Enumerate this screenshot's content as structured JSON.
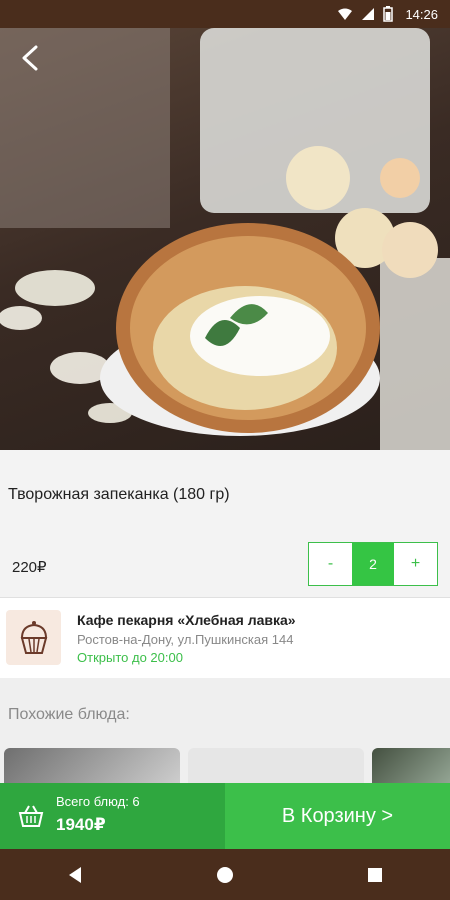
{
  "status_bar": {
    "time": "14:26"
  },
  "dish": {
    "title": "Творожная запеканка (180 гр)",
    "price": "220₽",
    "quantity": "2",
    "minus_label": "-",
    "plus_label": "+"
  },
  "cafe": {
    "name": "Кафе пекарня «Хлебная лавка»",
    "address": "Ростов-на-Дону, ул.Пушкинская 144",
    "hours": "Открыто до 20:00"
  },
  "similar": {
    "title": "Похожие блюда:"
  },
  "cart_bar": {
    "items_count": "Всего блюд: 6",
    "total": "1940₽",
    "to_cart": "В Корзину >"
  },
  "colors": {
    "accent_green": "#3cbf4a",
    "dark_green": "#2fa73f",
    "status_brown": "#4a2d1c"
  },
  "icons": {
    "back": "back-arrow-icon",
    "basket": "basket-icon",
    "cafe": "cupcake-icon"
  }
}
